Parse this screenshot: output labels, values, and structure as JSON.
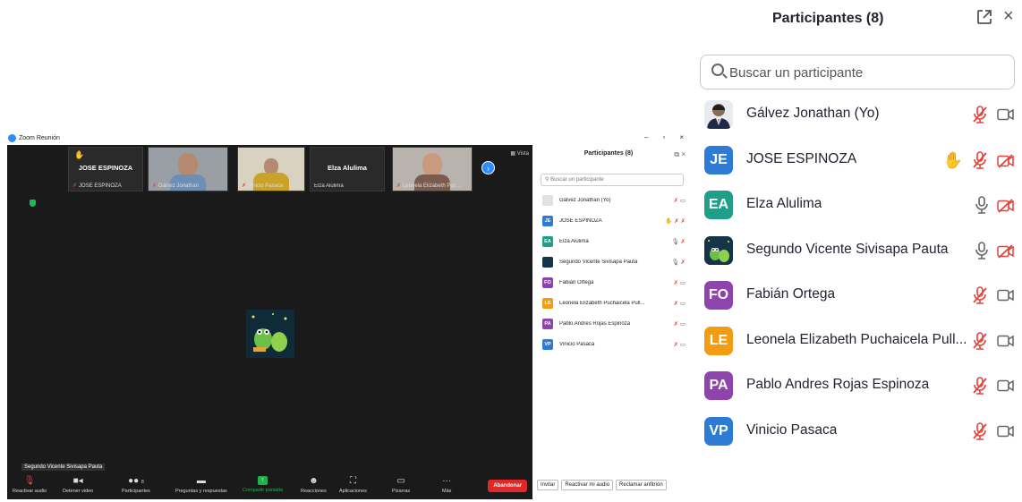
{
  "zoom_window": {
    "title": "Zoom Reunión",
    "vista_label": "Vista",
    "thumbnails": [
      {
        "big_name": "JOSE ESPINOZA",
        "label": "JOSE ESPINOZA",
        "hand": true
      },
      {
        "big_name": "",
        "label": "Gálvez Jonathan"
      },
      {
        "big_name": "",
        "label": "Vinicio  Pasaca"
      },
      {
        "big_name": "Elza Alulima",
        "label": "Elza Alulima"
      },
      {
        "big_name": "",
        "label": "Leonela Elizabeth Puc..."
      }
    ],
    "active_speaker": "Segundo Vicente Sivisapa Pauta",
    "toolbar": {
      "mute": "Reactivar audio",
      "video": "Detener video",
      "participants": "Participantes",
      "participants_count": "8",
      "qa": "Preguntas y respuestas",
      "share": "Compartir pantalla",
      "reactions": "Reacciones",
      "apps": "Aplicaciones",
      "whiteboard": "Pizarras",
      "more": "Más",
      "leave": "Abandonar"
    },
    "small_panel": {
      "title": "Participantes (8)",
      "search_placeholder": "Buscar un participante",
      "buttons": [
        "Invitar",
        "Reactivar mi audio",
        "Reclamar anfitrión"
      ],
      "participants": [
        {
          "initials": "",
          "name": "Gálvez Jonathan (Yo)"
        },
        {
          "initials": "JE",
          "name": "JOSE ESPINOZA"
        },
        {
          "initials": "EA",
          "name": "Elza Alulima"
        },
        {
          "initials": "",
          "name": "Segundo Vicente Sivisapa Pauta"
        },
        {
          "initials": "FO",
          "name": "Fabián Ortega"
        },
        {
          "initials": "LE",
          "name": "Leonela Elizabeth Puchaicela Pull..."
        },
        {
          "initials": "PA",
          "name": "Pablo Andres Rojas Espinoza"
        },
        {
          "initials": "VP",
          "name": "Vinicio  Pasaca"
        }
      ]
    }
  },
  "panel": {
    "title": "Participantes (8)",
    "search_placeholder": "Buscar un participante",
    "participants": [
      {
        "initials": "",
        "name": "Gálvez Jonathan (Yo)",
        "avatar": "photo",
        "color": "#e8ecf0",
        "hand": false,
        "mic": "off",
        "video": "on"
      },
      {
        "initials": "JE",
        "name": "JOSE ESPINOZA",
        "avatar": "initials",
        "color": "#2e7bd6",
        "hand": true,
        "mic": "off",
        "video": "off"
      },
      {
        "initials": "EA",
        "name": "Elza Alulima",
        "avatar": "initials",
        "color": "#1f9e89",
        "hand": false,
        "mic": "on",
        "video": "off"
      },
      {
        "initials": "",
        "name": "Segundo Vicente Sivisapa Pauta",
        "avatar": "image",
        "color": "#163447",
        "hand": false,
        "mic": "on",
        "video": "off"
      },
      {
        "initials": "FO",
        "name": "Fabián Ortega",
        "avatar": "initials",
        "color": "#8e44ad",
        "hand": false,
        "mic": "off",
        "video": "on"
      },
      {
        "initials": "LE",
        "name": "Leonela Elizabeth Puchaicela Pull...",
        "avatar": "initials",
        "color": "#f39c12",
        "hand": false,
        "mic": "off",
        "video": "on"
      },
      {
        "initials": "PA",
        "name": "Pablo Andres Rojas Espinoza",
        "avatar": "initials",
        "color": "#8e44ad",
        "hand": false,
        "mic": "off",
        "video": "on"
      },
      {
        "initials": "VP",
        "name": "Vinicio  Pasaca",
        "avatar": "initials",
        "color": "#2e7bd6",
        "hand": false,
        "mic": "off",
        "video": "on"
      }
    ],
    "colors": {
      "mic_off": "#e0443a",
      "icon_gray": "#666666",
      "hand": "#f5a623"
    }
  }
}
